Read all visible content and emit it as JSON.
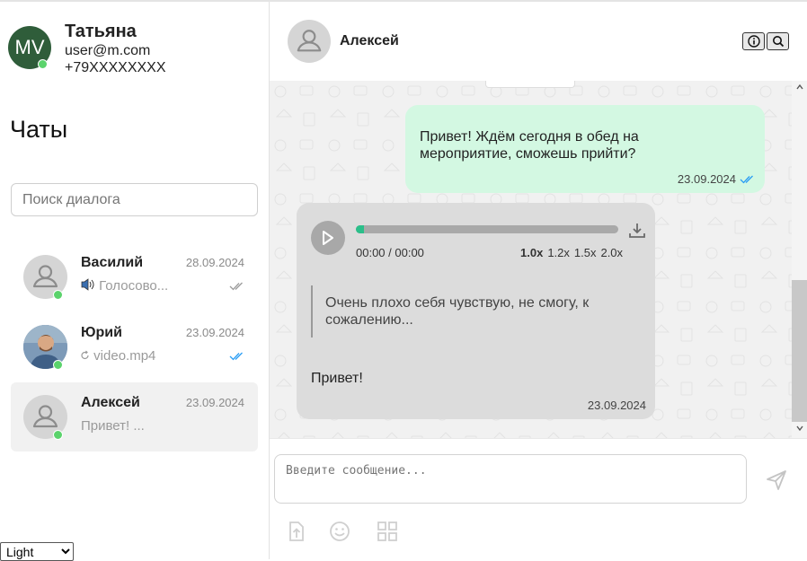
{
  "profile": {
    "initials": "MV",
    "name": "Татьяна",
    "email": "user@m.com",
    "phone": "+79XXXXXXXX"
  },
  "sidebar": {
    "title": "Чаты",
    "search_placeholder": "Поиск диалога",
    "chats": [
      {
        "name": "Василий",
        "date": "28.09.2024",
        "preview": "Голосово...",
        "preview_icon": "speaker-icon",
        "status": "delivered",
        "online": true
      },
      {
        "name": "Юрий",
        "date": "23.09.2024",
        "preview": "video.mp4",
        "preview_icon": "refresh-icon",
        "status": "read",
        "online": true
      },
      {
        "name": "Алексей",
        "date": "23.09.2024",
        "preview": "Привет! ...",
        "status": "none",
        "online": true,
        "active": true
      }
    ],
    "theme_options": [
      "Light"
    ],
    "theme_selected": "Light"
  },
  "conversation": {
    "contact_name": "Алексей",
    "header_buttons": [
      "info-icon",
      "search-icon"
    ],
    "messages": [
      {
        "direction": "outgoing",
        "text": "Привет! Ждём сегодня в обед на мероприятие, сможешь прийти?",
        "time": "23.09.2024",
        "status": "read"
      },
      {
        "direction": "incoming",
        "audio": {
          "time_readout": "00:00 / 00:00",
          "progress": 0.03,
          "speeds": [
            "1.0x",
            "1.2x",
            "1.5x",
            "2.0x"
          ],
          "speed_selected": "1.0x"
        },
        "quote": "Очень плохо себя чувствую, не смогу, к сожалению...",
        "text": "Привет!",
        "time": "23.09.2024"
      }
    ]
  },
  "composer": {
    "placeholder": "Введите сообщение...",
    "tools": [
      "upload-icon",
      "emoji-icon",
      "widgets-icon"
    ]
  },
  "colors": {
    "accent": "#2bbf8a",
    "outgoing_bubble": "#d3f8e2",
    "incoming_bubble": "#dcdcdc",
    "online": "#5bd36c",
    "read_check": "#2a9df4"
  }
}
